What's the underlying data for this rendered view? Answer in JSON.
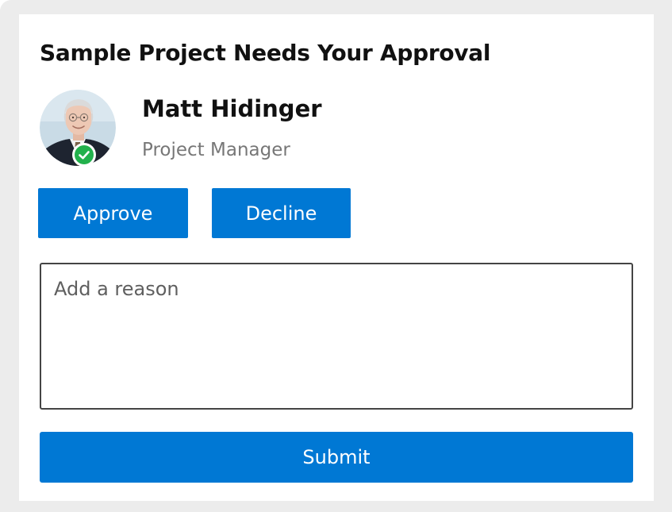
{
  "card": {
    "title": "Sample Project Needs Your Approval"
  },
  "person": {
    "name": "Matt Hidinger",
    "role": "Project Manager",
    "avatar_icon": "user-photo",
    "presence_icon": "check-circle-icon",
    "presence_status": "available",
    "presence_color": "#22b14c"
  },
  "actions": {
    "approve_label": "Approve",
    "decline_label": "Decline"
  },
  "reason": {
    "placeholder": "Add a reason",
    "value": ""
  },
  "submit": {
    "label": "Submit"
  },
  "colors": {
    "accent": "#0078d4",
    "frame": "#ececec",
    "card": "#ffffff"
  }
}
